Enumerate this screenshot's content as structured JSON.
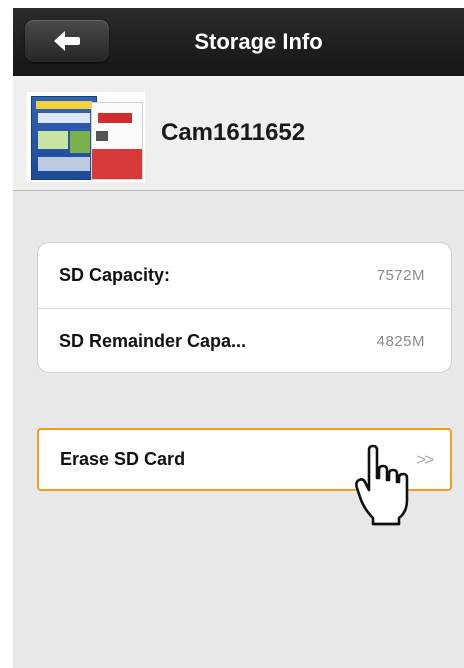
{
  "navbar": {
    "title": "Storage Info",
    "back_icon": "back-arrow-icon"
  },
  "camera": {
    "name": "Cam1611652",
    "thumbnail": "camera-product-box-image"
  },
  "storage": {
    "rows": [
      {
        "label": "SD Capacity:",
        "value": "7572M"
      },
      {
        "label": "SD Remainder Capa...",
        "value": "4825M"
      }
    ]
  },
  "actions": {
    "erase_label": "Erase SD Card",
    "erase_chevron": ">>"
  },
  "colors": {
    "navbar": "#1f1f1f",
    "background": "#e8e8e8",
    "highlight_border": "#f0a020",
    "value_text": "#8a8a8a"
  }
}
